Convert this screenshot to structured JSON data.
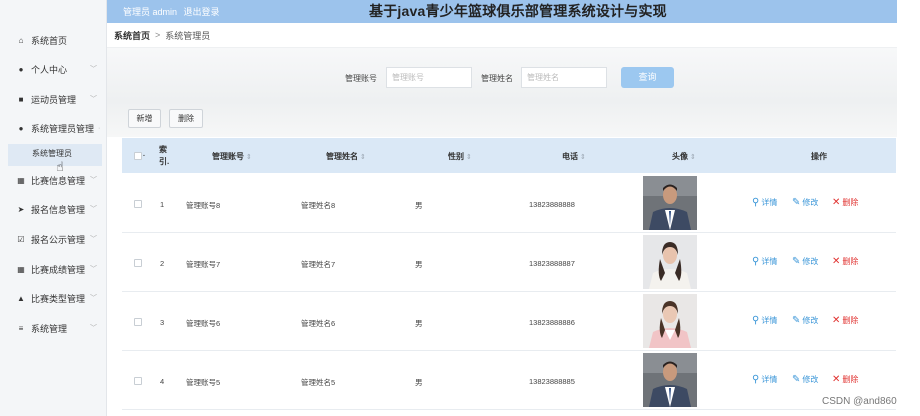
{
  "header": {
    "admin_text": "管理员 admin",
    "logout_label": "退出登录",
    "title": "基于java青少年篮球俱乐部管理系统设计与实现"
  },
  "sidebar": {
    "items": [
      {
        "label": "系统首页",
        "icon": "home-icon",
        "glyph": "⌂",
        "chevron": false
      },
      {
        "label": "个人中心",
        "icon": "user-icon",
        "glyph": "●",
        "chevron": true
      },
      {
        "label": "运动员管理",
        "icon": "briefcase-icon",
        "glyph": "■",
        "chevron": true
      },
      {
        "label": "系统管理员管理",
        "icon": "user-icon",
        "glyph": "●",
        "chevron": true,
        "expanded": true
      },
      {
        "label": "比赛信息管理",
        "icon": "grid-icon",
        "glyph": "▦",
        "chevron": true
      },
      {
        "label": "报名信息管理",
        "icon": "send-icon",
        "glyph": "➤",
        "chevron": true
      },
      {
        "label": "报名公示管理",
        "icon": "check-square-icon",
        "glyph": "☑",
        "chevron": true
      },
      {
        "label": "比赛成绩管理",
        "icon": "grid-icon",
        "glyph": "▦",
        "chevron": true
      },
      {
        "label": "比赛类型管理",
        "icon": "thumbs-up-icon",
        "glyph": "▲",
        "chevron": true
      },
      {
        "label": "系统管理",
        "icon": "list-icon",
        "glyph": "≡",
        "chevron": true
      }
    ],
    "active_subitem": "系统管理员"
  },
  "breadcrumb": {
    "home": "系统首页",
    "separator": ">",
    "current": "系统管理员"
  },
  "search": {
    "account_label": "管理账号",
    "account_placeholder": "管理账号",
    "name_label": "管理姓名",
    "name_placeholder": "管理姓名",
    "search_button": "查询"
  },
  "actions": {
    "add_button": "新增",
    "delete_button": "删除"
  },
  "table": {
    "columns": {
      "index_line1": "索",
      "index_line2": "引.",
      "account": "管理账号",
      "name": "管理姓名",
      "gender": "性别",
      "phone": "电话",
      "avatar": "头像",
      "operation": "操作"
    },
    "sort_glyph": "⇕",
    "row_actions": {
      "detail": "详情",
      "edit": "修改",
      "delete": "删除"
    },
    "rows": [
      {
        "index": "1",
        "account": "管理账号8",
        "name": "管理姓名8",
        "gender": "男",
        "phone": "13823888888",
        "photo": "man"
      },
      {
        "index": "2",
        "account": "管理账号7",
        "name": "管理姓名7",
        "gender": "男",
        "phone": "13823888887",
        "photo": "woman-white"
      },
      {
        "index": "3",
        "account": "管理账号6",
        "name": "管理姓名6",
        "gender": "男",
        "phone": "13823888886",
        "photo": "woman-pink"
      },
      {
        "index": "4",
        "account": "管理账号5",
        "name": "管理姓名5",
        "gender": "男",
        "phone": "13823888885",
        "photo": "man"
      }
    ]
  },
  "watermark": "CSDN @and860",
  "colors": {
    "header_bg": "#9cc3ec",
    "table_header_bg": "#dae8f6",
    "search_button": "#9cc8f0",
    "link_blue": "#3a96d8",
    "delete_red": "#e0312f"
  }
}
